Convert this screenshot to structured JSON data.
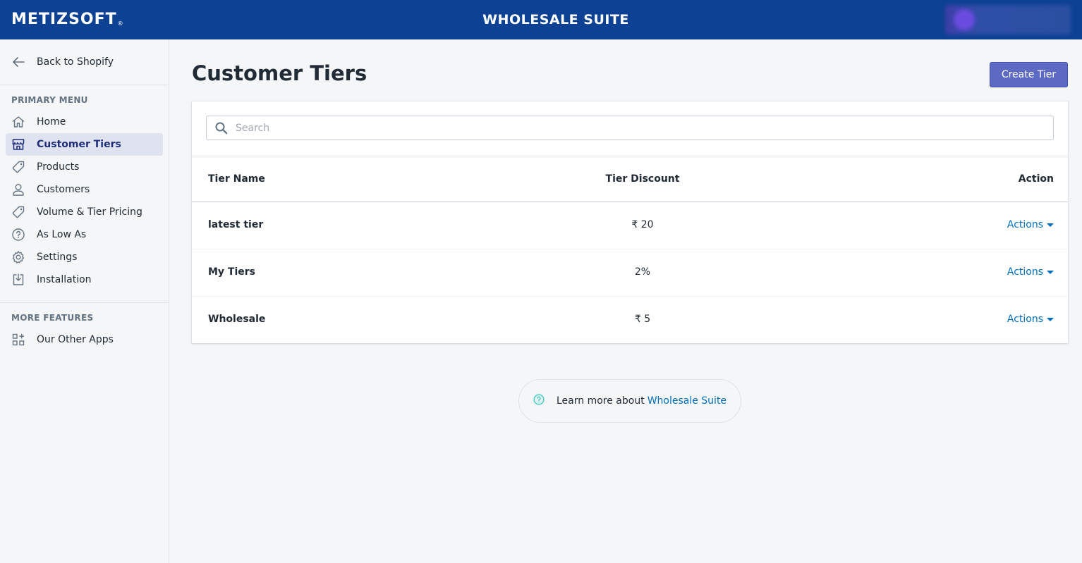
{
  "topbar": {
    "logo": "METIZSOFT",
    "logo_mark": "®",
    "app_title": "WHOLESALE SUITE"
  },
  "sidebar": {
    "back_label": "Back to Shopify",
    "primary_title": "PRIMARY MENU",
    "primary_items": [
      {
        "label": "Home",
        "icon": "home-icon"
      },
      {
        "label": "Customer Tiers",
        "icon": "store-icon",
        "active": true
      },
      {
        "label": "Products",
        "icon": "tag-icon"
      },
      {
        "label": "Customers",
        "icon": "person-icon"
      },
      {
        "label": "Volume & Tier Pricing",
        "icon": "tag-icon"
      },
      {
        "label": "As Low As",
        "icon": "question-circle-icon"
      },
      {
        "label": "Settings",
        "icon": "gear-icon"
      },
      {
        "label": "Installation",
        "icon": "import-icon"
      }
    ],
    "more_title": "MORE FEATURES",
    "more_items": [
      {
        "label": "Our Other Apps",
        "icon": "apps-icon"
      }
    ]
  },
  "main": {
    "title": "Customer Tiers",
    "create_button": "Create Tier",
    "search_placeholder": "Search",
    "columns": [
      "Tier Name",
      "Tier Discount",
      "Action"
    ],
    "rows": [
      {
        "name": "latest tier",
        "discount": "₹ 20",
        "action": "Actions"
      },
      {
        "name": "My Tiers",
        "discount": "2%",
        "action": "Actions"
      },
      {
        "name": "Wholesale",
        "discount": "₹ 5",
        "action": "Actions"
      }
    ],
    "learn_text": "Learn more about",
    "learn_link": "Wholesale Suite"
  },
  "colors": {
    "topbar": "#0c4193",
    "primary_button": "#5c6ac4",
    "link": "#006fbb",
    "active_nav_bg": "#dfe3f0",
    "active_nav_text": "#202e78"
  }
}
